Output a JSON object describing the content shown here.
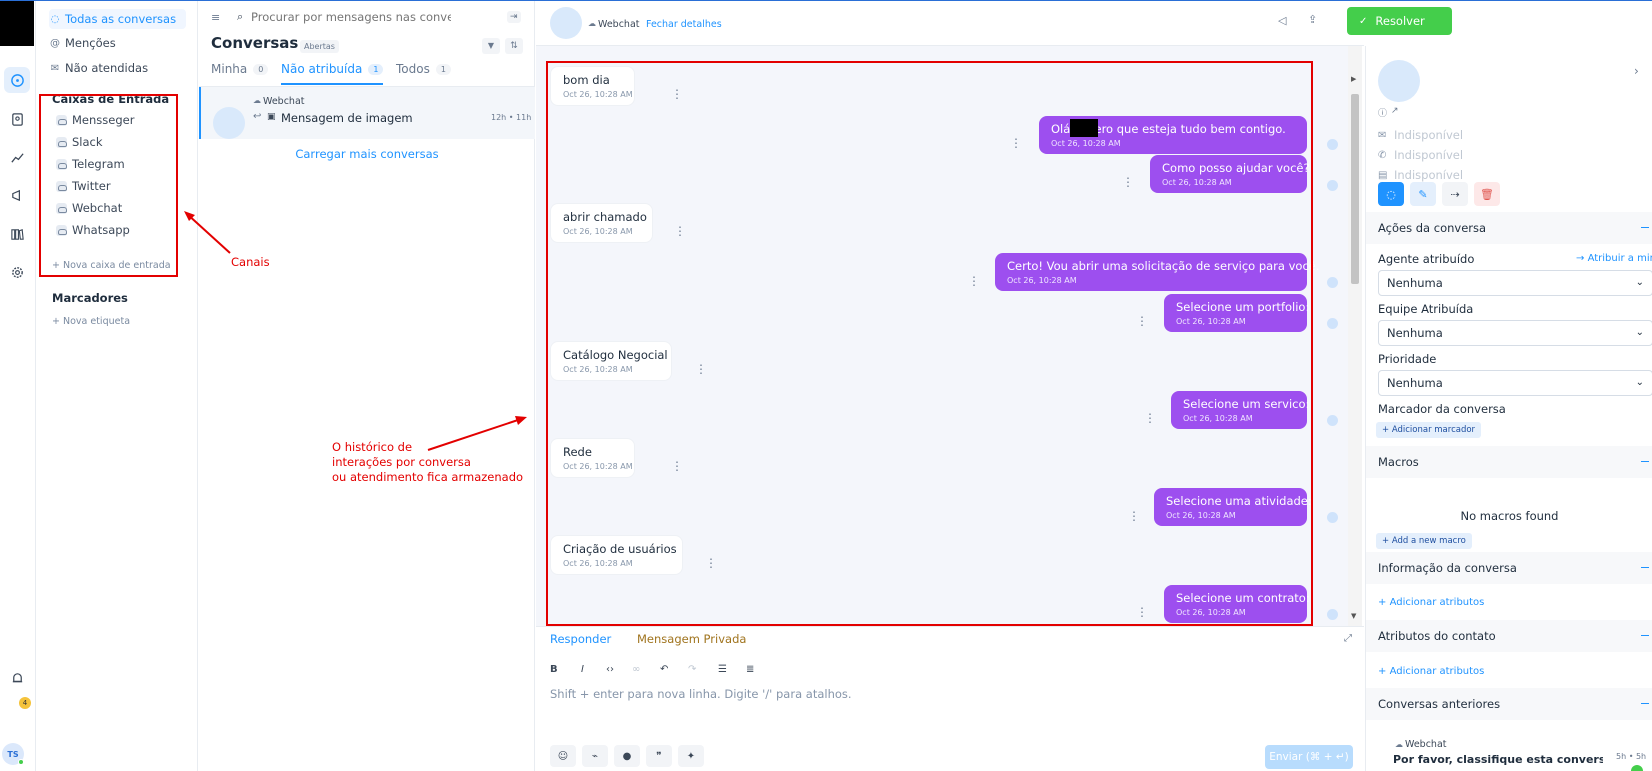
{
  "sidebar": {
    "items": [
      {
        "label": "Todas as conversas"
      },
      {
        "label": "Menções"
      },
      {
        "label": "Não atendidas"
      }
    ],
    "inboxes_title": "Caixas de Entrada",
    "inboxes": [
      {
        "label": "Mensseger"
      },
      {
        "label": "Slack"
      },
      {
        "label": "Telegram"
      },
      {
        "label": "Twitter"
      },
      {
        "label": "Webchat"
      },
      {
        "label": "Whatsapp"
      }
    ],
    "new_inbox": "+ Nova caixa de entrada",
    "labels_title": "Marcadores",
    "new_label": "+ Nova etiqueta"
  },
  "rail": {
    "notification_count": "4",
    "avatar_initials": "TS"
  },
  "annotations": {
    "channels": "Canais",
    "history_line1": "O histórico de",
    "history_line2": "interações por conversa",
    "history_line3": "ou atendimento fica armazenado"
  },
  "convlist": {
    "search_placeholder": "Procurar por mensagens nas conversas",
    "title": "Conversas",
    "status_pill": "Abertas",
    "tabs": [
      {
        "label": "Minha",
        "count": "0"
      },
      {
        "label": "Não atribuída",
        "count": "1"
      },
      {
        "label": "Todos",
        "count": "1"
      }
    ],
    "card": {
      "inbox": "Webchat",
      "preview": "Mensagem de imagem",
      "time": "12h • 11h"
    },
    "load_more": "Carregar mais conversas"
  },
  "chat": {
    "header_inbox": "Webchat",
    "header_link": "Fechar detalhes",
    "resolve": "Resolver",
    "messages": [
      {
        "dir": "in",
        "text": "bom dia",
        "time": "Oct 26, 10:28 AM"
      },
      {
        "dir": "out",
        "text": "Olá       Espero que esteja tudo bem contigo.",
        "time": "Oct 26, 10:28 AM"
      },
      {
        "dir": "out",
        "text": "Como posso ajudar você?",
        "time": "Oct 26, 10:28 AM"
      },
      {
        "dir": "in",
        "text": "abrir chamado",
        "time": "Oct 26, 10:28 AM"
      },
      {
        "dir": "out",
        "text": "Certo! Vou abrir uma solicitação de serviço para você.",
        "time": "Oct 26, 10:28 AM"
      },
      {
        "dir": "out",
        "text": "Selecione um portfolio:",
        "time": "Oct 26, 10:28 AM"
      },
      {
        "dir": "in",
        "text": "Catálogo Negocial",
        "time": "Oct 26, 10:28 AM"
      },
      {
        "dir": "out",
        "text": "Selecione um servico:",
        "time": "Oct 26, 10:28 AM"
      },
      {
        "dir": "in",
        "text": "Rede",
        "time": "Oct 26, 10:28 AM"
      },
      {
        "dir": "out",
        "text": "Selecione uma atividade:",
        "time": "Oct 26, 10:28 AM"
      },
      {
        "dir": "in",
        "text": "Criação de usuários",
        "time": "Oct 26, 10:28 AM"
      },
      {
        "dir": "out",
        "text": "Selecione um contrato:",
        "time": "Oct 26, 10:28 AM"
      }
    ],
    "composer": {
      "tab_reply": "Responder",
      "tab_private": "Mensagem Privada",
      "placeholder": "Shift + enter para nova linha. Digite '/' para atalhos.",
      "send": "Enviar (⌘ + ↵)"
    }
  },
  "panel": {
    "contact": [
      "Indisponível",
      "Indisponível",
      "Indisponível"
    ],
    "sections": {
      "actions": "Ações da conversa",
      "macros": "Macros",
      "info": "Informação da conversa",
      "contact_attrs": "Atributos do contato",
      "previous": "Conversas anteriores"
    },
    "agent_label": "Agente atribuído",
    "assign_me": "Atribuir a mim",
    "agent_value": "Nenhuma",
    "team_label": "Equipe Atribuída",
    "team_value": "Nenhuma",
    "priority_label": "Prioridade",
    "priority_value": "Nenhuma",
    "tag_label": "Marcador da conversa",
    "add_tag": "Adicionar marcador",
    "no_macros": "No macros found",
    "add_macro": "Add a new macro",
    "add_attr1": "Adicionar atributos",
    "add_attr2": "Adicionar atributos",
    "prev_inbox": "Webchat",
    "prev_text": "Por favor, classifique esta conversa, ...",
    "prev_time": "5h • 5h"
  }
}
